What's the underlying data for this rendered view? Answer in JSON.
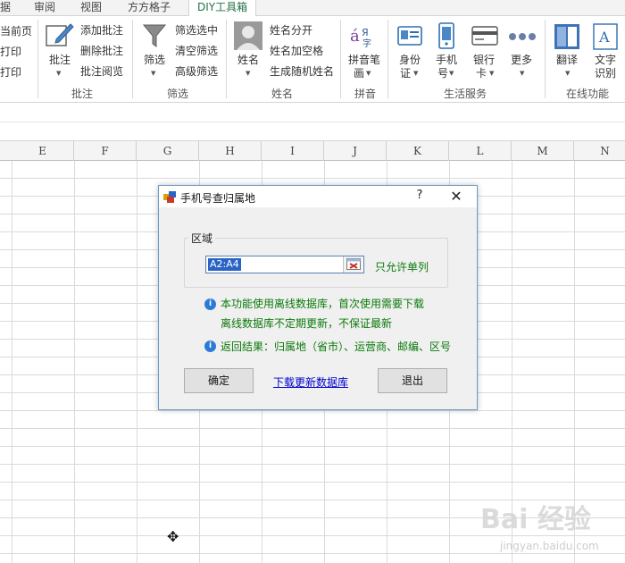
{
  "tabs": [
    {
      "label": "据"
    },
    {
      "label": "审阅"
    },
    {
      "label": "视图"
    },
    {
      "label": "方方格子"
    },
    {
      "label": "DIY工具箱",
      "active": true
    }
  ],
  "ribbon": {
    "print_group": {
      "items": [
        "当前页",
        "打印",
        "打印"
      ]
    },
    "comment_group": {
      "big_button": "批注",
      "items": [
        "添加批注",
        "删除批注",
        "批注阅览"
      ],
      "label": "批注"
    },
    "filter_group": {
      "big_button": "筛选",
      "items": [
        "筛选选中",
        "清空筛选",
        "高级筛选"
      ],
      "label": "筛选"
    },
    "name_group": {
      "big_button": "姓名",
      "items": [
        "姓名分开",
        "姓名加空格",
        "生成随机姓名"
      ],
      "label": "姓名"
    },
    "pinyin_group": {
      "big_button_line1": "拼音笔",
      "big_button_line2": "画",
      "label": "拼音"
    },
    "life_group": {
      "buttons": [
        {
          "line1": "身份",
          "line2": "证"
        },
        {
          "line1": "手机",
          "line2": "号"
        },
        {
          "line1": "银行",
          "line2": "卡"
        },
        {
          "line1": "更多",
          "line2": ""
        }
      ],
      "label": "生活服务"
    },
    "online_group": {
      "buttons": [
        {
          "line1": "翻译",
          "line2": ""
        },
        {
          "line1": "文字",
          "line2": "识别"
        }
      ],
      "label": "在线功能"
    }
  },
  "columns": [
    "E",
    "F",
    "G",
    "H",
    "I",
    "J",
    "K",
    "L",
    "M",
    "N"
  ],
  "dialog": {
    "title": "手机号查归属地",
    "help": "?",
    "close": "✕",
    "group_label": "区域",
    "range_value": "A2:A4",
    "single_column_note": "只允许单列",
    "info_line1": "本功能使用离线数据库，首次使用需要下载",
    "info_line2": "离线数据库不定期更新，不保证最新",
    "info_line3": "返回结果：归属地（省市）、运营商、邮编、区号",
    "ok_button": "确定",
    "download_link": "下载更新数据库",
    "exit_button": "退出"
  },
  "watermark": {
    "text": "Bai  经验",
    "sub": "jingyan.baidu.com"
  },
  "colors": {
    "accent": "#217346",
    "dialog_border": "#6c9bc7",
    "info_text": "#0a7a0a",
    "link": "#0000cc"
  }
}
